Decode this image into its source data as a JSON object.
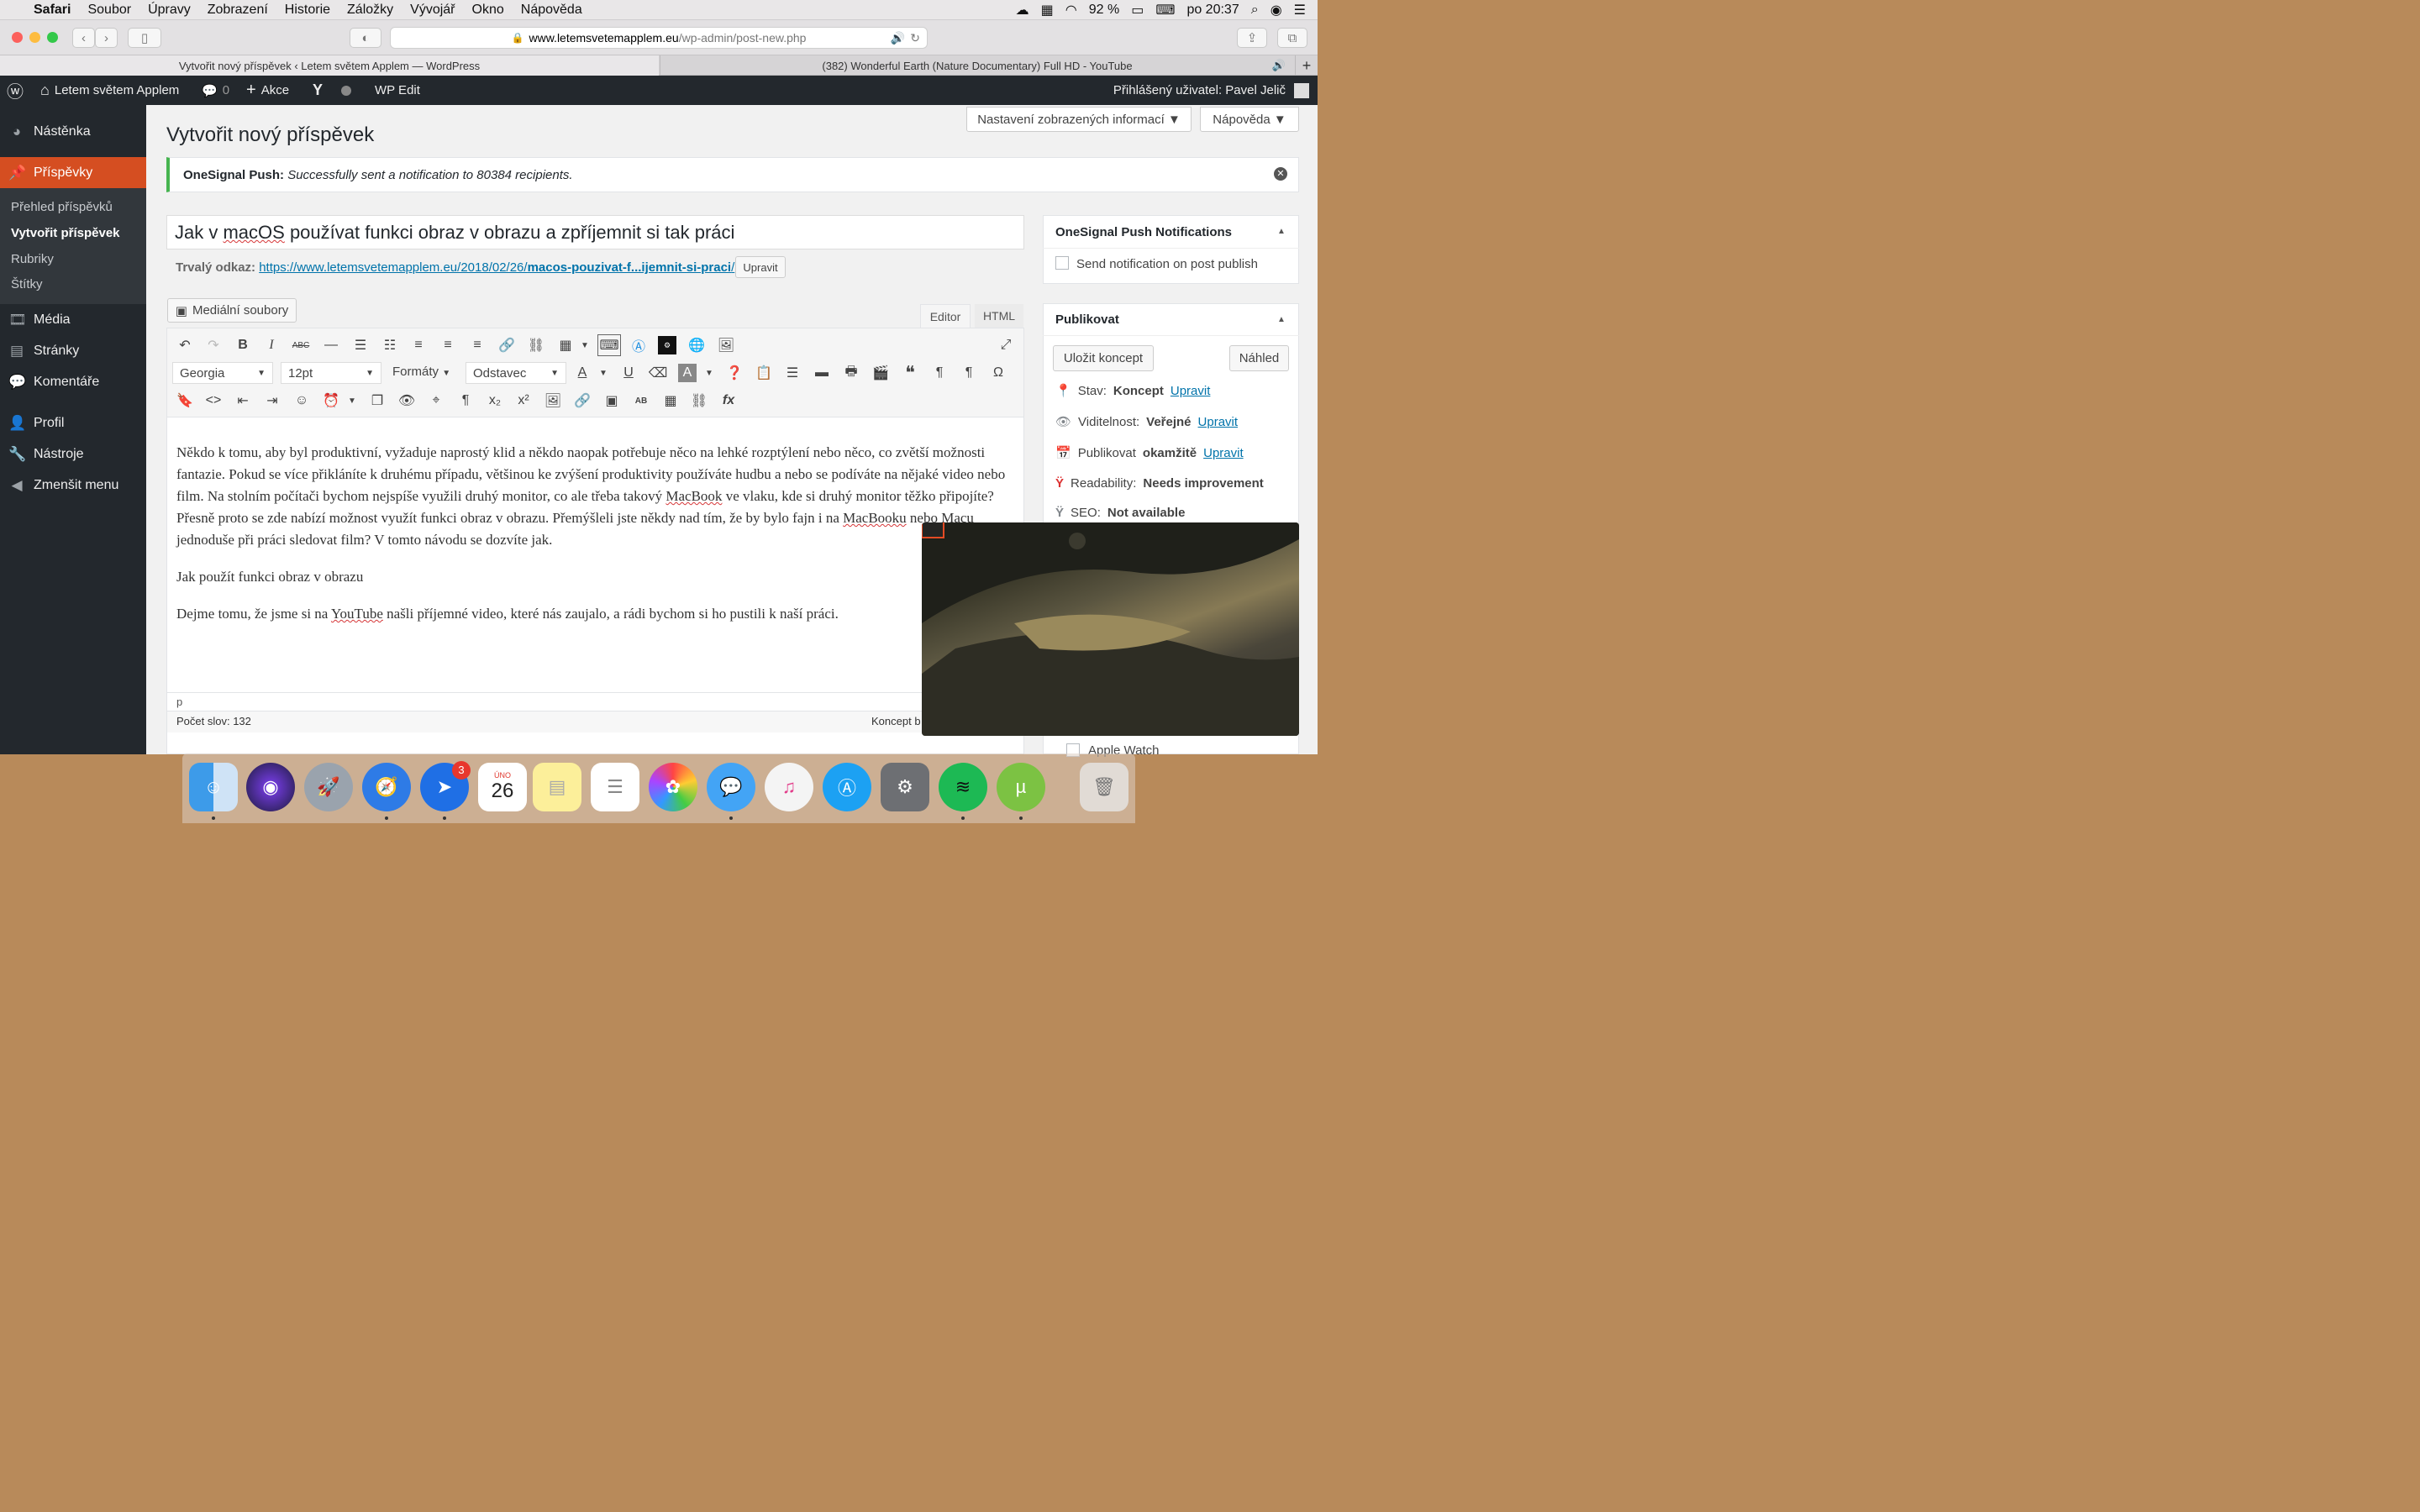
{
  "menubar": {
    "apple": "",
    "app": "Safari",
    "items": [
      "Soubor",
      "Úpravy",
      "Zobrazení",
      "Historie",
      "Záložky",
      "Vývojář",
      "Okno",
      "Nápověda"
    ],
    "battery": "92 %",
    "clock": "po 20:37"
  },
  "browser": {
    "url_domain": "www.letemsvetemapplem.eu",
    "url_path": "/wp-admin/post-new.php",
    "tabs": [
      "Vytvořit nový příspěvek ‹ Letem světem Applem — WordPress",
      "(382) Wonderful Earth (Nature Documentary) Full HD - YouTube"
    ],
    "new_tab": "+"
  },
  "adminbar": {
    "site": "Letem světem Applem",
    "comments": "0",
    "new": "Akce",
    "wpedit": "WP Edit",
    "user": "Přihlášený uživatel: Pavel Jelič"
  },
  "sidebar": {
    "dashboard": "Nástěnka",
    "posts": "Příspěvky",
    "sub": [
      "Přehled příspěvků",
      "Vytvořit příspěvek",
      "Rubriky",
      "Štítky"
    ],
    "media": "Média",
    "pages": "Stránky",
    "comments": "Komentáře",
    "profile": "Profil",
    "tools": "Nástroje",
    "collapse": "Zmenšit menu"
  },
  "screen_options": "Nastavení zobrazených informací ▼",
  "help": "Nápověda ▼",
  "page_title": "Vytvořit nový příspěvek",
  "notice": {
    "label": "OneSignal Push:",
    "text": "Successfully sent a notification to 80384 recipients."
  },
  "post": {
    "title_pre": "Jak v ",
    "title_err": "macOS",
    "title_post": " používat funkci obraz v obrazu a zpříjemnit si tak práci",
    "permalink_label": "Trvalý odkaz:",
    "permalink_base": "https://www.letemsvetemapplem.eu/2018/02/26/",
    "permalink_slug": "macos-pouzivat-f...ijemnit-si-praci",
    "permalink_end": "/",
    "edit_btn": "Upravit"
  },
  "editor": {
    "media_btn": "Mediální soubory",
    "tab_editor": "Editor",
    "tab_html": "HTML",
    "font": "Georgia",
    "size": "12pt",
    "formats": "Formáty",
    "block": "Odstavec",
    "p1a": "Někdo k tomu, aby byl produktivní, vyžaduje naprostý klid a někdo naopak potřebuje něco na lehké rozptýlení nebo něco, co zvětší možnosti fantazie. Pokud se více přikláníte k druhému případu, většinou ke zvýšení produktivity používáte hudbu a nebo se podíváte na nějaké video nebo film. Na stolním počítači bychom nejspíše využili druhý monitor, co ale třeba takový ",
    "p1b": "MacBook",
    "p1c": " ve vlaku, kde si druhý monitor těžko připojíte? Přesně proto se zde nabízí možnost využít funkci obraz v obrazu. Přemýšleli jste někdy nad tím, že by bylo fajn i na ",
    "p1d": "MacBooku",
    "p1e": " nebo Macu jednoduše při práci sledovat film? V tomto návodu se dozvíte jak.",
    "p2": "Jak použít funkci obraz v obrazu",
    "p3a": "Dejme tomu, že jsme si na ",
    "p3b": "YouTube",
    "p3c": " našli příjemné video, které nás zaujalo, a rádi bychom si ho pustili k naší práci.",
    "path": "p",
    "wordcount": "Počet slov: 132",
    "draft": "Koncept b"
  },
  "onesignal": {
    "title": "OneSignal Push Notifications",
    "checkbox": "Send notification on post publish"
  },
  "publish": {
    "title": "Publikovat",
    "save": "Uložit koncept",
    "preview": "Náhled",
    "status_l": "Stav:",
    "status_v": "Koncept",
    "visibility_l": "Viditelnost:",
    "visibility_v": "Veřejné",
    "time_l": "Publikovat",
    "time_v": "okamžitě",
    "edit": "Upravit",
    "read_l": "Readability:",
    "read_v": "Needs improvement",
    "seo_l": "SEO:",
    "seo_v": "Not available"
  },
  "category_item": "Apple Watch",
  "dock": {
    "badge": "3",
    "cal_month": "ÚNO",
    "cal_day": "26"
  }
}
